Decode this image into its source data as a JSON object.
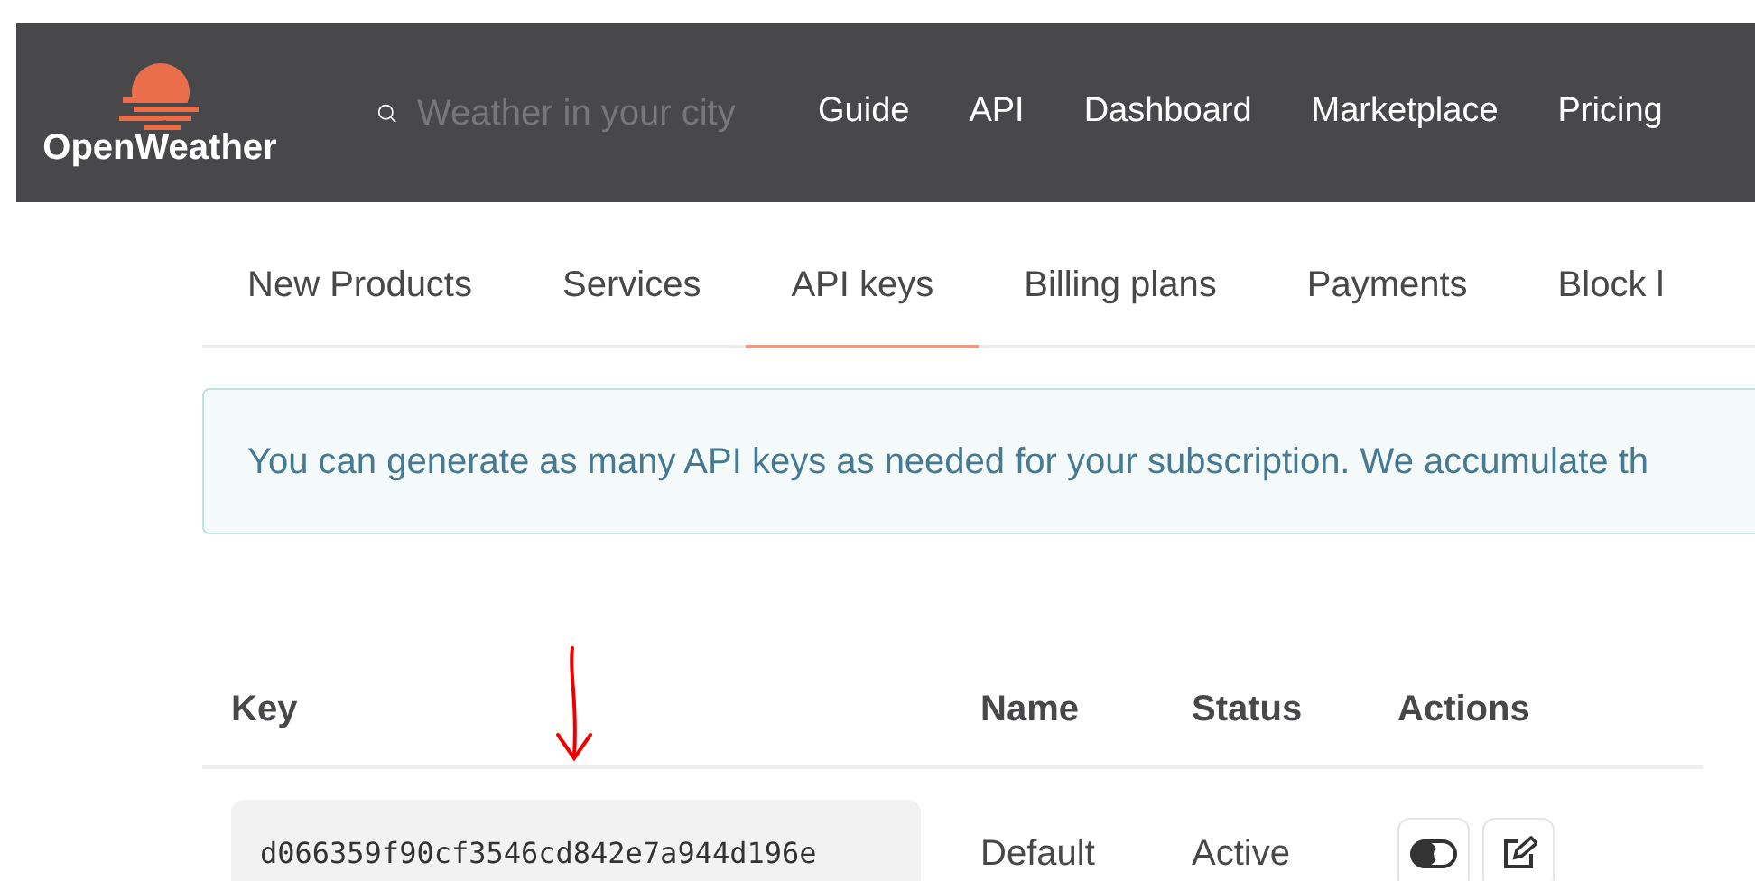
{
  "header": {
    "logo": "OpenWeather",
    "search": {
      "placeholder": "Weather in your city"
    },
    "nav": [
      "Guide",
      "API",
      "Dashboard",
      "Marketplace",
      "Pricing"
    ]
  },
  "tabs": [
    {
      "label": "New Products",
      "selected": false
    },
    {
      "label": "Services",
      "selected": false
    },
    {
      "label": "API keys",
      "selected": true
    },
    {
      "label": "Billing plans",
      "selected": false
    },
    {
      "label": "Payments",
      "selected": false
    },
    {
      "label": "Block l",
      "selected": false
    }
  ],
  "alert": "You can generate as many API keys as needed for your subscription. We accumulate th",
  "table": {
    "columns": [
      "Key",
      "Name",
      "Status",
      "Actions"
    ],
    "rows": [
      {
        "key": "d066359f90cf3546cd842e7a944d196e",
        "name": "Default",
        "status": "Active",
        "actions": [
          {
            "kind": "toggle"
          },
          {
            "kind": "edit"
          }
        ]
      }
    ]
  }
}
